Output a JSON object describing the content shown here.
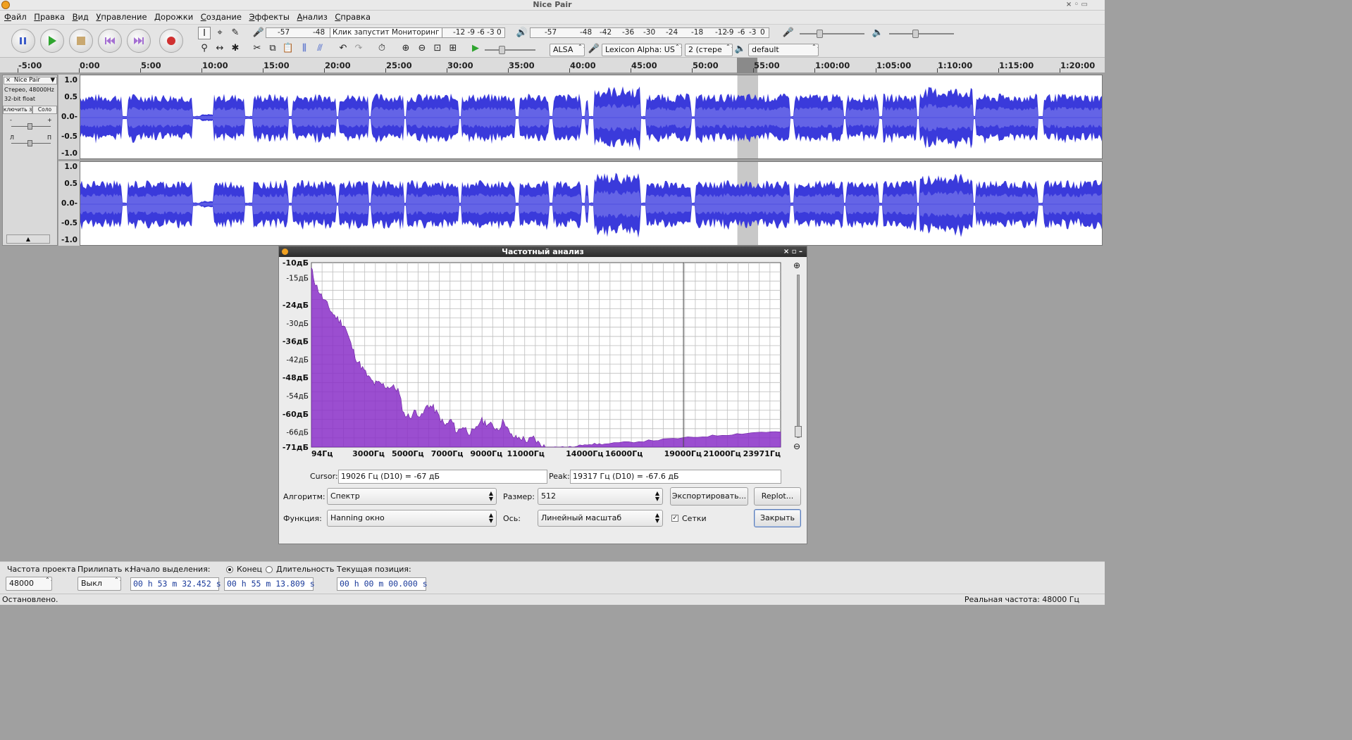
{
  "window": {
    "title": "Nice Pair"
  },
  "menu": [
    "Файл",
    "Правка",
    "Вид",
    "Управление",
    "Дорожки",
    "Создание",
    "Эффекты",
    "Анализ",
    "Справка"
  ],
  "toolbar": {
    "rec_meter_ticks": [
      "-57",
      "-48"
    ],
    "monitor_text": "Клик запустит Мониторинг",
    "rec_meter_ticks_right": [
      "-12",
      "-9",
      "-6",
      "-3",
      "0"
    ],
    "play_meter_ticks": [
      "-57",
      "-48",
      "-42",
      "-36",
      "-30",
      "-24",
      "-18",
      "-12",
      "-9",
      "-6",
      "-3",
      "0"
    ],
    "host": "ALSA",
    "rec_device": "Lexicon Alpha: US",
    "channels": "2 (стере",
    "play_device": "default"
  },
  "ruler": {
    "ticks": [
      "-5:00",
      "0:00",
      "5:00",
      "10:00",
      "15:00",
      "20:00",
      "25:00",
      "30:00",
      "35:00",
      "40:00",
      "45:00",
      "50:00",
      "55:00",
      "1:00:00",
      "1:05:00",
      "1:10:00",
      "1:15:00",
      "1:20:00"
    ],
    "selection": {
      "start_min": 53.54,
      "end_min": 55.23
    }
  },
  "track": {
    "name": "Nice Pair",
    "info1": "Стерео, 48000Hz",
    "info2": "32-bit float",
    "mute": "ключить звук",
    "solo": "Соло",
    "gain_minus": "-",
    "gain_plus": "+",
    "pan_left": "Л",
    "pan_right": "П",
    "scale": [
      "1.0",
      "0.5",
      "0.0-",
      "-0.5",
      "-1.0"
    ]
  },
  "analyzer": {
    "title": "Частотный анализ",
    "y_labels": [
      "-10дБ",
      "-15дБ",
      "-24дБ",
      "-30дБ",
      "-36дБ",
      "-42дБ",
      "-48дБ",
      "-54дБ",
      "-60дБ",
      "-66дБ",
      "-71дБ"
    ],
    "x_labels": [
      "94Гц",
      "3000Гц",
      "5000Гц",
      "7000Гц",
      "9000Гц",
      "11000Гц",
      "14000Гц",
      "16000Гц",
      "19000Гц",
      "21000Гц",
      "23971Гц"
    ],
    "cursor_label": "Cursor:",
    "cursor_value": "19026 Гц (D10) = -67 дБ",
    "peak_label": "Peak:",
    "peak_value": "19317 Гц (D10) = -67.6 дБ",
    "algorithm_label": "Алгоритм:",
    "algorithm_value": "Спектр",
    "size_label": "Размер:",
    "size_value": "512",
    "export_button": "Экспортировать...",
    "replot_button": "Replot...",
    "function_label": "Функция:",
    "function_value": "Hanning окно",
    "axis_label": "Ось:",
    "axis_value": "Линейный масштаб",
    "grid_label": "Сетки",
    "grid_checked": true,
    "close_button": "Закрыть",
    "accent_color": "#8a2fc8"
  },
  "chart_data": {
    "type": "area",
    "xlabel": "",
    "ylabel": "",
    "xlim": [
      94,
      23971
    ],
    "ylim": [
      -71,
      -10
    ],
    "x": [
      94,
      300,
      600,
      900,
      1200,
      1500,
      1800,
      2100,
      2400,
      2700,
      3000,
      3300,
      3600,
      3900,
      4200,
      4500,
      4800,
      5100,
      5400,
      5700,
      6000,
      6300,
      6600,
      6900,
      7200,
      7500,
      7800,
      8100,
      8400,
      8700,
      9000,
      9300,
      9600,
      9900,
      10200,
      10500,
      10800,
      11100,
      11400,
      11700,
      12000,
      12500,
      13000,
      13500,
      14000,
      14500,
      15000,
      16000,
      17000,
      18000,
      19000,
      20000,
      21000,
      22000,
      23000,
      23971
    ],
    "y": [
      -12,
      -17,
      -21,
      -24,
      -27,
      -29,
      -31,
      -37,
      -42,
      -45,
      -48,
      -50,
      -50,
      -51,
      -51,
      -52,
      -60,
      -61,
      -59,
      -61,
      -57,
      -58,
      -61,
      -64,
      -62,
      -66,
      -64,
      -66,
      -66,
      -62,
      -63,
      -64,
      -65,
      -62,
      -67,
      -68,
      -68,
      -69,
      -68,
      -70,
      -71,
      -71,
      -71,
      -71,
      -70,
      -70,
      -70,
      -69.5,
      -69,
      -68.5,
      -68,
      -67.5,
      -67,
      -66.5,
      -66,
      -66
    ]
  },
  "bottom": {
    "rate_label": "Частота проекта",
    "rate_value": "48000",
    "snap_label": "Прилипать к:",
    "snap_value": "Выкл",
    "sel_start_label": "Начало выделения:",
    "end_label": "Конец",
    "length_label": "Длительность",
    "pos_label": "Текущая позиция:",
    "sel_start": "00 h 53 m 32.452 s",
    "sel_end": "00 h 55 m 13.809 s",
    "position": "00 h 00 m 00.000 s"
  },
  "status": {
    "left": "Остановлено.",
    "right": "Реальная частота: 48000 Гц"
  }
}
